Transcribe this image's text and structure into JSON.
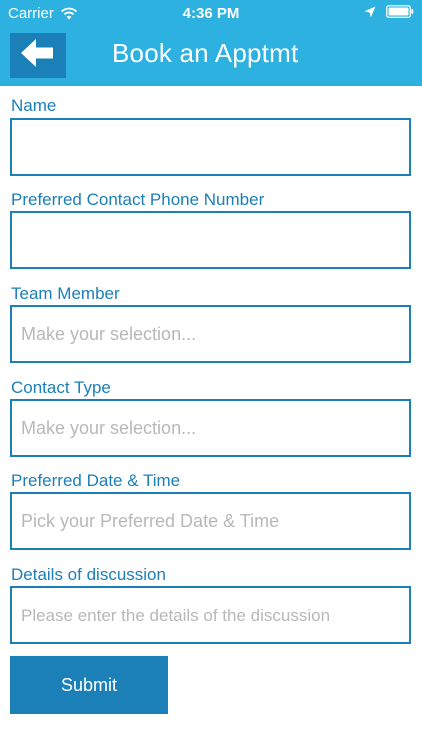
{
  "status_bar": {
    "carrier": "Carrier",
    "time": "4:36 PM"
  },
  "header": {
    "title": "Book an Apptmt",
    "back_icon": "arrow-left-icon"
  },
  "form": {
    "name": {
      "label": "Name",
      "value": "",
      "placeholder": ""
    },
    "phone": {
      "label": "Preferred Contact Phone Number",
      "value": "",
      "placeholder": ""
    },
    "team_member": {
      "label": "Team Member",
      "value": "",
      "placeholder": "Make your selection..."
    },
    "contact_type": {
      "label": "Contact Type",
      "value": "",
      "placeholder": "Make your selection..."
    },
    "date_time": {
      "label": "Preferred Date & Time",
      "value": "",
      "placeholder": "Pick your Preferred Date & Time"
    },
    "details": {
      "label": "Details of discussion",
      "value": "",
      "placeholder": "Please enter the details of the discussion"
    },
    "submit_label": "Submit"
  },
  "colors": {
    "header_bg": "#2cb1e0",
    "accent": "#1b7fb8",
    "placeholder": "#b8b8b8"
  }
}
